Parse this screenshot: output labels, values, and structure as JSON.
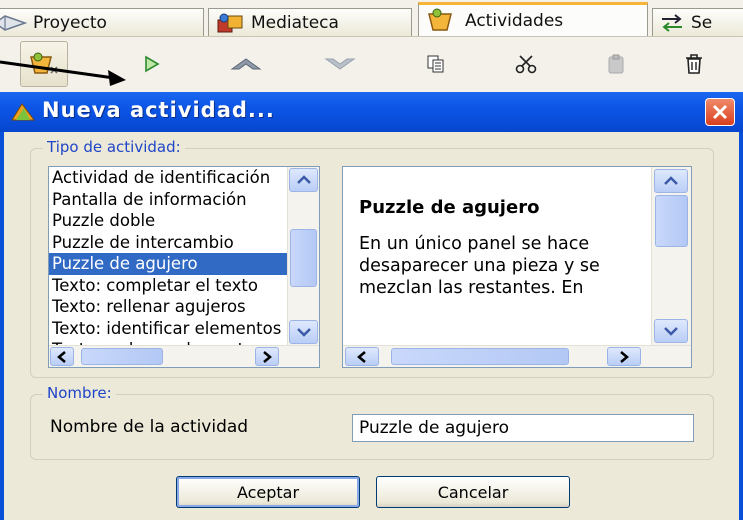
{
  "tabs": [
    {
      "label": "Proyecto",
      "icon": "project-icon"
    },
    {
      "label": "Mediateca",
      "icon": "media-library-icon"
    },
    {
      "label": "Actividades",
      "icon": "activities-icon",
      "active": true
    },
    {
      "label": "Se",
      "icon": "sequences-icon"
    }
  ],
  "toolbar": {
    "buttons": [
      "new-activity-icon",
      "play-icon",
      "move-up-icon",
      "move-down-icon",
      "copy-icon",
      "cut-icon",
      "paste-icon",
      "delete-icon"
    ]
  },
  "dialog": {
    "title": "Nueva actividad...",
    "type_group": {
      "legend": "Tipo de actividad:",
      "items": [
        "Actividad de identificación",
        "Pantalla de información",
        "Puzzle doble",
        "Puzzle de intercambio",
        "Puzzle de agujero",
        "Texto: completar el texto",
        "Texto: rellenar agujeros",
        "Texto: identificar elementos",
        "Texto: ordenar elementos"
      ],
      "selected_index": 4
    },
    "description": {
      "title": "Puzzle de agujero",
      "body": "En un único panel se hace desaparecer una pieza y se mezclan las restantes. En"
    },
    "name_group": {
      "legend": "Nombre:",
      "field_label": "Nombre de la actividad",
      "field_value": "Puzzle de agujero"
    },
    "buttons": {
      "ok": "Aceptar",
      "cancel": "Cancelar"
    }
  },
  "colors": {
    "title_bar": "#0c55e6",
    "selection": "#316ac5",
    "legend_text": "#1f45c8",
    "close_button": "#d9401e"
  }
}
